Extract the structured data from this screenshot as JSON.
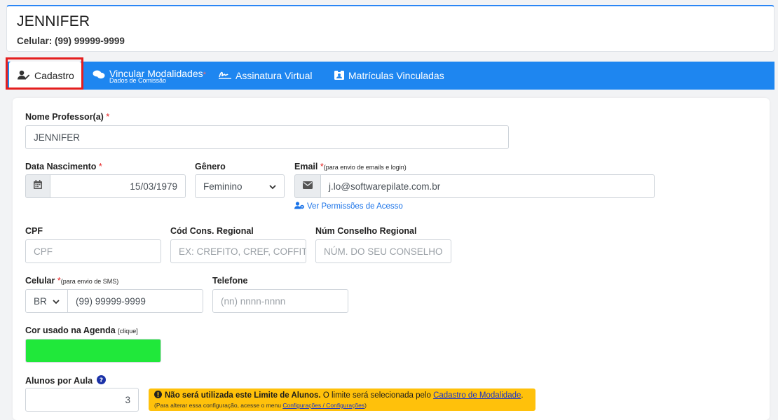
{
  "header": {
    "name": "JENNIFER",
    "phone": "Celular: (99) 99999-9999"
  },
  "tabs": [
    {
      "label": "Cadastro",
      "sub": ""
    },
    {
      "label": "Vincular Modalidades",
      "sub": "Dados de Comissão",
      "required": "*"
    },
    {
      "label": "Assinatura Virtual",
      "sub": ""
    },
    {
      "label": "Matrículas Vinculadas",
      "sub": ""
    }
  ],
  "form": {
    "required_mark": "*",
    "nome": {
      "label": "Nome Professor(a)",
      "value": "JENNIFER"
    },
    "nascimento": {
      "label": "Data Nascimento",
      "value": "15/03/1979"
    },
    "genero": {
      "label": "Gênero",
      "value": "Feminino"
    },
    "email": {
      "label": "Email",
      "note": "(para envio de emails e login)",
      "value": "j.lo@softwarepilate.com.br"
    },
    "permissoes_link": "Ver Permissões de Acesso",
    "cpf": {
      "label": "CPF",
      "placeholder": "CPF"
    },
    "cod_cons": {
      "label": "Cód Cons. Regional",
      "placeholder": "EX: CREFITO, CREF, COFFITO"
    },
    "num_cons": {
      "label": "Núm Conselho Regional",
      "placeholder": "NÚM. DO SEU CONSELHO"
    },
    "celular": {
      "label": "Celular",
      "note": "(para envio de SMS)",
      "country": "BR",
      "value": "(99) 99999-9999"
    },
    "telefone": {
      "label": "Telefone",
      "placeholder": "(nn) nnnn-nnnn"
    },
    "cor": {
      "label": "Cor usado na Agenda",
      "note": "[clique]",
      "color": "#20e83a"
    },
    "alunos": {
      "label": "Alunos por Aula",
      "value": "3"
    },
    "aviso": {
      "bold": "Não será utilizada este Limite de Alunos.",
      "text": "O limite será selecionada pelo",
      "link": "Cadastro de Modalidade",
      "end": ".",
      "line2_text": "(Para alterar essa configuração, acesse o menu",
      "line2_link": "Configurações / Configurações",
      "line2_end": ")"
    }
  },
  "colors": {
    "accent": "#1e86f0",
    "highlight": "#e41e1e",
    "warning": "#ffc10b"
  }
}
